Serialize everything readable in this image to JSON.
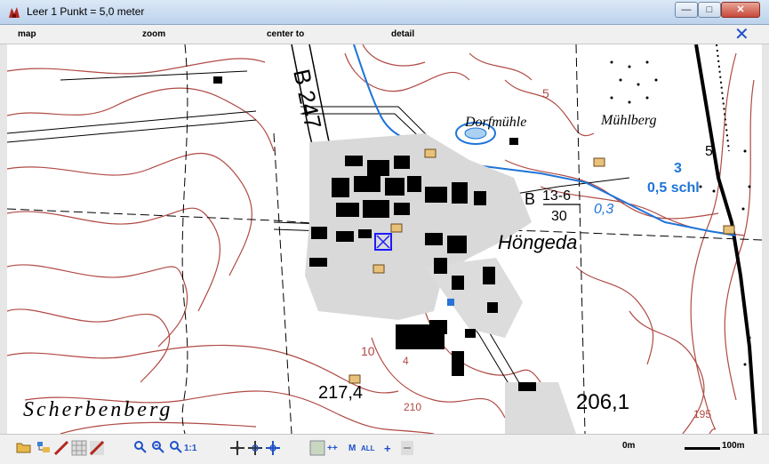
{
  "window": {
    "title": "Leer 1 Punkt = 5,0 meter",
    "minimize_label": "—",
    "maximize_label": "□",
    "close_label": "✕"
  },
  "menu": {
    "items": [
      "map",
      "zoom",
      "center to",
      "detail"
    ],
    "close_label": "✕"
  },
  "map": {
    "labels": {
      "road": "B 247",
      "dorfmuehle": "Dorfmühle",
      "muehlberg": "Mühlberg",
      "hoengeda": "Höngeda",
      "scherbenberg": "Scherbenberg",
      "elev1": "217,4",
      "elev2": "206,1",
      "road_b": "B",
      "road_num_top": "13-6",
      "road_num_bottom": "30",
      "stream_3": "3",
      "stream_05": "0,5 schl",
      "stream_03": "0,3",
      "contour_10": "10",
      "contour_5": "5",
      "contour_5b": "5",
      "contour_210": "210",
      "contour_195": "195",
      "contour_4": "4"
    },
    "colors": {
      "contour": "#b04a44",
      "water": "#1e74d8",
      "ink": "#000000",
      "marker": "#1a1aff"
    }
  },
  "toolbar": {
    "scale_left": "0m",
    "scale_right": "100m",
    "zoom_1to1": "1:1",
    "btn_plusplus": "++",
    "btn_m": "M",
    "btn_all": "ALL",
    "btn_plus": "+",
    "icons": [
      "open-folder-icon",
      "layers-icon",
      "no-track-icon",
      "grid-icon",
      "no-route-icon",
      "zoom-in-icon",
      "zoom-out-icon",
      "zoom-fit-icon",
      "center-point-icon",
      "center-track-icon",
      "crosshair-icon",
      "map-tile-icon",
      "minus-icon"
    ]
  }
}
